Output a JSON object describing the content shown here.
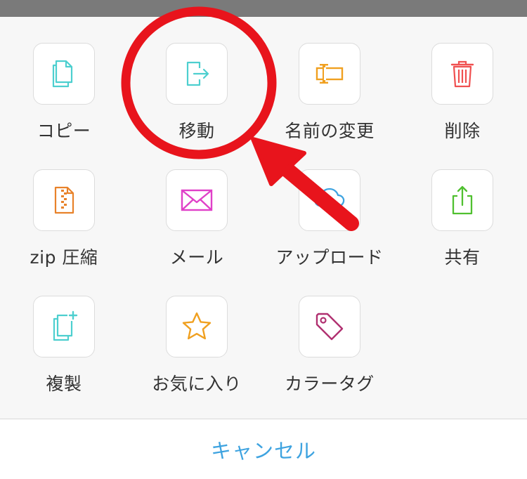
{
  "actions": [
    {
      "label": "コピー",
      "icon": "copy-icon",
      "color": "#4dcfcf"
    },
    {
      "label": "移動",
      "icon": "move-icon",
      "color": "#4dcfcf"
    },
    {
      "label": "名前の変更",
      "icon": "rename-icon",
      "color": "#f0a020"
    },
    {
      "label": "削除",
      "icon": "trash-icon",
      "color": "#f05050"
    },
    {
      "label": "zip 圧縮",
      "icon": "zip-file-icon",
      "color": "#e8822a"
    },
    {
      "label": "メール",
      "icon": "mail-icon",
      "color": "#e040c8"
    },
    {
      "label": "アップロード",
      "icon": "cloud-upload-icon",
      "color": "#3ea3e0"
    },
    {
      "label": "共有",
      "icon": "share-icon",
      "color": "#50c030"
    },
    {
      "label": "複製",
      "icon": "duplicate-icon",
      "color": "#4dcfcf"
    },
    {
      "label": "お気に入り",
      "icon": "star-icon",
      "color": "#f0a020"
    },
    {
      "label": "カラータグ",
      "icon": "tag-icon",
      "color": "#b03070"
    }
  ],
  "cancel_label": "キャンセル",
  "colors": {
    "accent": "#3ea3e0",
    "annotation": "#e8141c"
  }
}
